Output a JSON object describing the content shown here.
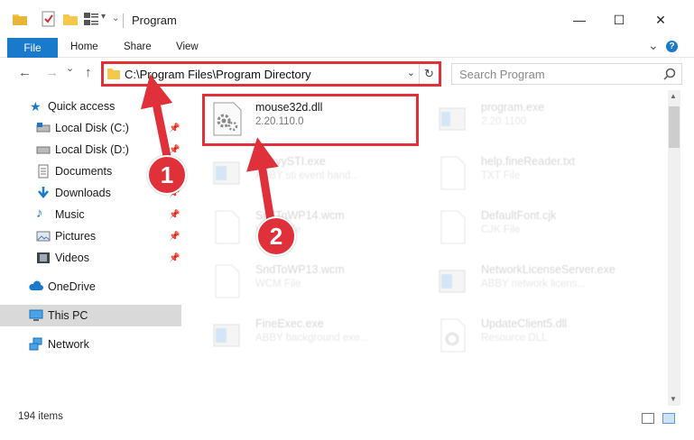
{
  "window": {
    "title": "Program",
    "minimize": "—",
    "maximize": "☐",
    "close": "✕"
  },
  "ribbon": {
    "file": "File",
    "tabs": [
      "Home",
      "Share",
      "View"
    ],
    "expand": "⌄",
    "help": "?"
  },
  "address": {
    "path": "C:\\Program Files\\Program Directory",
    "dropdown": "⌄",
    "refresh": "↻"
  },
  "search": {
    "placeholder": "Search Program"
  },
  "nav": {
    "back": "←",
    "forward": "→",
    "recent": "⌄",
    "up": "↑",
    "items": [
      {
        "label": "Quick access",
        "pinned": false
      },
      {
        "label": "Local Disk (C:)",
        "pinned": true
      },
      {
        "label": "Local Disk (D:)",
        "pinned": true
      },
      {
        "label": "Documents",
        "pinned": true
      },
      {
        "label": "Downloads",
        "pinned": true
      },
      {
        "label": "Music",
        "pinned": true
      },
      {
        "label": "Pictures",
        "pinned": true
      },
      {
        "label": "Videos",
        "pinned": true
      },
      {
        "label": "OneDrive",
        "pinned": false
      },
      {
        "label": "This PC",
        "pinned": false
      },
      {
        "label": "Network",
        "pinned": false
      }
    ],
    "pin_glyph": "📌"
  },
  "files": [
    {
      "name": "mouse32d.dll",
      "meta": "2.20.110.0"
    },
    {
      "name": "program.exe",
      "meta": "2.20.1100"
    },
    {
      "name": "AbbyySTI.exe",
      "meta": "ABBY sti event hand..."
    },
    {
      "name": "help.fineReader.txt",
      "meta": "TXT File"
    },
    {
      "name": "SndToWP14.wcm",
      "meta": "WCM File"
    },
    {
      "name": "DefaultFont.cjk",
      "meta": "CJK File"
    },
    {
      "name": "SndToWP13.wcm",
      "meta": "WCM File"
    },
    {
      "name": "NetworkLicenseServer.exe",
      "meta": "ABBY network licens..."
    },
    {
      "name": "FineExec.exe",
      "meta": "ABBY background exe..."
    },
    {
      "name": "UpdateClient5.dll",
      "meta": "Resource DLL"
    }
  ],
  "status": {
    "count": "194 items"
  },
  "annotations": {
    "step1": "1",
    "step2": "2",
    "color": "#e0303a"
  }
}
